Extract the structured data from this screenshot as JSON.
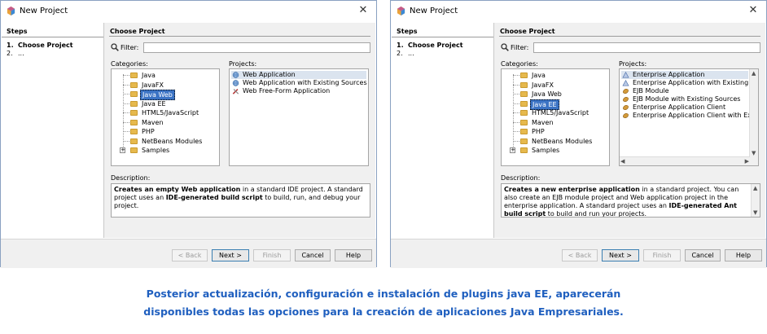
{
  "caption": {
    "line1": "Posterior actualización, configuración e instalación de plugins java EE, aparecerán",
    "line2": "disponibles todas las opciones para la creación de aplicaciones Java Empresariales."
  },
  "dialogs": [
    {
      "title": "New Project",
      "steps_header": "Steps",
      "steps": [
        {
          "num": "1.",
          "label": "Choose Project"
        },
        {
          "num": "2.",
          "label": "..."
        }
      ],
      "main_header": "Choose Project",
      "filter_label": "Filter:",
      "filter_value": "",
      "categories_label": "Categories:",
      "projects_label": "Projects:",
      "categories": [
        "Java",
        "JavaFX",
        "Java Web",
        "Java EE",
        "HTML5/JavaScript",
        "Maven",
        "PHP",
        "NetBeans Modules",
        "Samples"
      ],
      "selected_category": "Java Web",
      "projects": [
        "Web Application",
        "Web Application with Existing Sources",
        "Web Free-Form Application"
      ],
      "project_icons": [
        "globe-icon",
        "globe-icon",
        "tools-icon"
      ],
      "description_label": "Description:",
      "description": {
        "p1_bold": "Creates an empty Web application",
        "p1_rest": " in a standard IDE project. A standard project uses an ",
        "p2_bold": "IDE-generated build script",
        "p2_rest": " to build, run, and debug your project."
      },
      "buttons": {
        "back": "< Back",
        "next": "Next >",
        "finish": "Finish",
        "cancel": "Cancel",
        "help": "Help"
      }
    },
    {
      "title": "New Project",
      "steps_header": "Steps",
      "steps": [
        {
          "num": "1.",
          "label": "Choose Project"
        },
        {
          "num": "2.",
          "label": "..."
        }
      ],
      "main_header": "Choose Project",
      "filter_label": "Filter:",
      "filter_value": "",
      "categories_label": "Categories:",
      "projects_label": "Projects:",
      "categories": [
        "Java",
        "JavaFX",
        "Java Web",
        "Java EE",
        "HTML5/JavaScript",
        "Maven",
        "PHP",
        "NetBeans Modules",
        "Samples"
      ],
      "selected_category": "Java EE",
      "projects": [
        "Enterprise Application",
        "Enterprise Application with Existing Sources",
        "EJB Module",
        "EJB Module with Existing Sources",
        "Enterprise Application Client",
        "Enterprise Application Client with Existing S"
      ],
      "project_icons": [
        "triangle-icon",
        "triangle-icon",
        "bean-icon",
        "bean-icon",
        "bean-icon",
        "bean-icon"
      ],
      "description_label": "Description:",
      "description": {
        "p1_bold": "Creates a new enterprise application",
        "p1_rest": " in a standard project. You can also create an EJB module project and Web application project in the enterprise application. A standard project uses an ",
        "p2_bold": "IDE-generated Ant build script",
        "p2_rest": " to build and run your projects."
      },
      "buttons": {
        "back": "< Back",
        "next": "Next >",
        "finish": "Finish",
        "cancel": "Cancel",
        "help": "Help"
      }
    }
  ],
  "colors": {
    "selection": "#3b73c4",
    "caption": "#1f5fbf",
    "highlight_row": "#dbe4ef"
  }
}
